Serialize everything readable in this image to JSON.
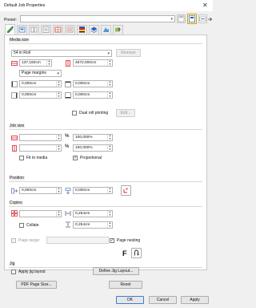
{
  "window": {
    "title": "Default Job Properties",
    "close_glyph": "✕"
  },
  "preset": {
    "label": "Preset:",
    "value": ""
  },
  "toolbar": {
    "icons": [
      "save-preset-icon",
      "favorites-icon",
      "spellcheck-icon",
      "import-preset-icon"
    ]
  },
  "tabs": [
    "general-tab",
    "output-tab",
    "color-tab",
    "printer-tab",
    "layout-tab",
    "marks-tab",
    "color-bar-tab",
    "prepress-tab",
    "finishing-tab",
    "tools-tab"
  ],
  "media_size": {
    "title": "Media size",
    "media_value": "54 in Roll",
    "remove_label": "Remove",
    "width": "137,160cm",
    "height": "4572,000cm",
    "margins_value": "Page margins",
    "margin_left": "0,000cm",
    "margin_top": "0,000cm",
    "margin_right": "0,000cm",
    "margin_bottom": "0,000cm",
    "dual_roll_label": "Dual roll printing",
    "edit_label": "Edit..."
  },
  "job_size": {
    "title": "Job size",
    "width_value": "",
    "height_value": "",
    "scale_x": "100,000%",
    "scale_y": "100,000%",
    "fit_label": "Fit to media",
    "proportional_label": "Proportional"
  },
  "position": {
    "title": "Position",
    "x": "0,000cm",
    "y": "0,000cm"
  },
  "copies": {
    "title": "Copies",
    "count": "",
    "spacing_h": "0,254cm",
    "spacing_v": "0,254cm",
    "collate_label": "Collate",
    "page_range_label": "Page range:",
    "page_range_value": "",
    "page_nesting_label": "Page nesting",
    "f_label": "F"
  },
  "jig": {
    "title": "Jig",
    "apply_label": "Apply jig layout",
    "define_label": "Define Jig Layout...",
    "pdf_label": "PDF Page Size...",
    "reset_label": "Reset"
  },
  "footer": {
    "ok": "OK",
    "cancel": "Cancel",
    "apply": "Apply"
  },
  "colors": {
    "accent_red": "#d9232e",
    "accent_blue": "#2b5fb3",
    "panel_bg": "#ffffff",
    "dialog_bg": "#f0f0f0"
  }
}
